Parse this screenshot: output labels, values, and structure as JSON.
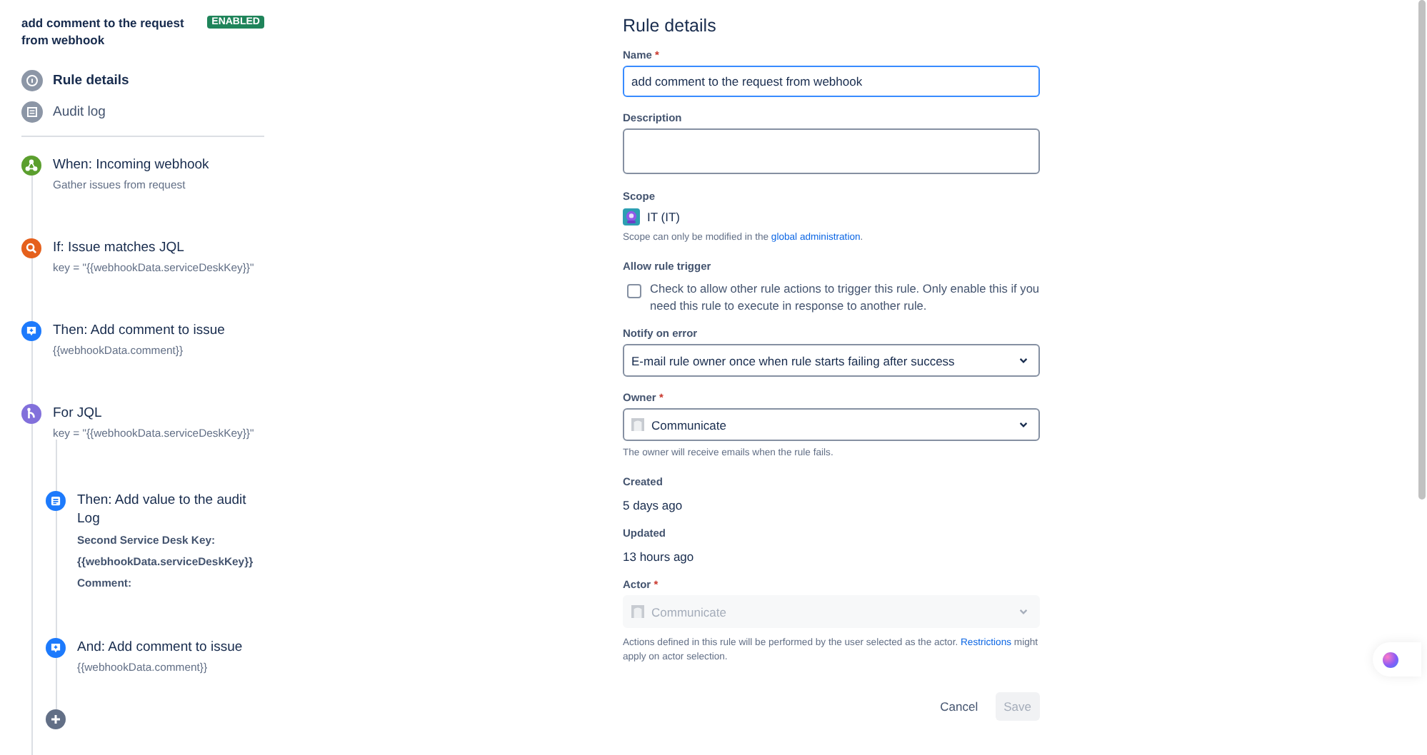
{
  "rule": {
    "title": "add comment to the request from webhook",
    "status": "ENABLED"
  },
  "nav": [
    {
      "label": "Rule details",
      "kind": "info",
      "selected": true
    },
    {
      "label": "Audit log",
      "kind": "log",
      "selected": false
    }
  ],
  "steps": [
    {
      "kind": "trigger",
      "title": "When: Incoming webhook",
      "detail": "Gather issues from request"
    },
    {
      "kind": "condition",
      "title": "If: Issue matches JQL",
      "detail": "key = \"{{webhookData.serviceDeskKey}}\""
    },
    {
      "kind": "action",
      "title": "Then: Add comment to issue",
      "detail": "{{webhookData.comment}}"
    },
    {
      "kind": "branch",
      "title": "For JQL",
      "detail": "key = \"{{webhookData.serviceDeskKey}}\"",
      "children": [
        {
          "kind": "audit",
          "title": "Then: Add value to the audit Log",
          "detail_lines": [
            "Second Service Desk Key:",
            "{{webhookData.serviceDeskKey}}",
            "Comment:"
          ]
        },
        {
          "kind": "action",
          "title": "And: Add comment to issue",
          "detail": "{{webhookData.comment}}"
        }
      ]
    }
  ],
  "form": {
    "title": "Rule details",
    "name": {
      "label": "Name",
      "required_mark": "*",
      "value": "add comment to the request from webhook"
    },
    "description": {
      "label": "Description"
    },
    "scope": {
      "label": "Scope",
      "value": "IT (IT)",
      "help_before": "Scope can only be modified in the ",
      "help_link": "global administration",
      "help_after": "."
    },
    "allow_trigger": {
      "label": "Allow rule trigger",
      "checked": false,
      "text": "Check to allow other rule actions to trigger this rule. Only enable this if you need this rule to execute in response to another rule."
    },
    "notify": {
      "label": "Notify on error",
      "value": "E-mail rule owner once when rule starts failing after success"
    },
    "owner": {
      "label": "Owner",
      "required_mark": "*",
      "value": "Communicate",
      "help": "The owner will receive emails when the rule fails."
    },
    "created": {
      "label": "Created",
      "value": "5 days ago"
    },
    "updated": {
      "label": "Updated",
      "value": "13 hours ago"
    },
    "actor": {
      "label": "Actor",
      "required_mark": "*",
      "value": "Communicate",
      "disabled": true,
      "help_before": "Actions defined in this rule will be performed by the user selected as the actor. ",
      "help_link": "Restrictions",
      "help_after": " might apply on actor selection."
    },
    "buttons": [
      {
        "label": "Cancel",
        "kind": "subtle",
        "disabled": false
      },
      {
        "label": "Save",
        "kind": "primary",
        "disabled": true
      }
    ]
  }
}
